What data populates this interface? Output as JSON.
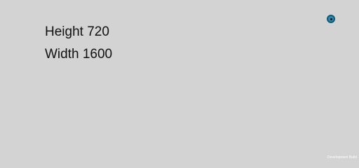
{
  "screen": {
    "background": "#d3d3d3"
  },
  "info": {
    "height_label": "Height 720",
    "width_label": "Width 1600"
  },
  "indicator": {
    "icon": "record-dot-icon",
    "color": "#2f86a5"
  },
  "watermark": {
    "text": "Development Build"
  }
}
